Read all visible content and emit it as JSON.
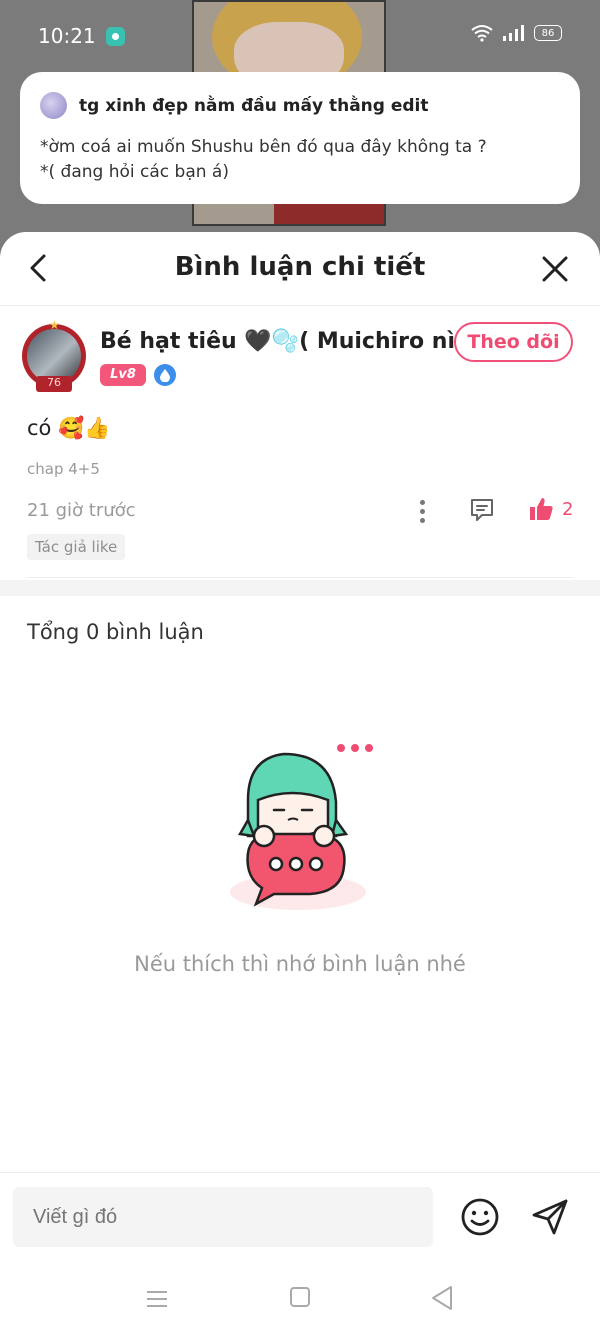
{
  "status_bar": {
    "time": "10:21",
    "battery": "86"
  },
  "notification": {
    "title": "tg xinh đẹp nằm đầu mấy thằng edit",
    "body": "*ờm coá ai muốn Shushu bên đó qua đây không ta ?\n*( đang hỏi các bạn á)"
  },
  "sheet": {
    "title": "Bình luận chi tiết"
  },
  "comment": {
    "username": "Bé hạt tiêu 🖤🫧( Muichiro nì)",
    "level_badge": "Lv8",
    "avatar_level": "76",
    "follow_label": "Theo dõi",
    "text": "có 🥰👍",
    "chapter": "chap 4+5",
    "time_ago": "21 giờ trước",
    "like_count": "2",
    "author_liked": "Tác giả like"
  },
  "comments_section": {
    "total_label": "Tổng 0 bình luận",
    "empty_text": "Nếu thích thì nhớ bình luận nhé"
  },
  "input": {
    "placeholder": "Viết gì đó"
  },
  "colors": {
    "accent": "#ef4c74",
    "level_badge": "#f2567a",
    "drop_badge": "#3b8ee9"
  },
  "icons": [
    "back-icon",
    "close-icon",
    "more-icon",
    "reply-icon",
    "like-icon",
    "emoji-icon",
    "send-icon",
    "menu-icon",
    "home-icon",
    "nav-back-icon",
    "wifi-icon",
    "signal-icon"
  ]
}
